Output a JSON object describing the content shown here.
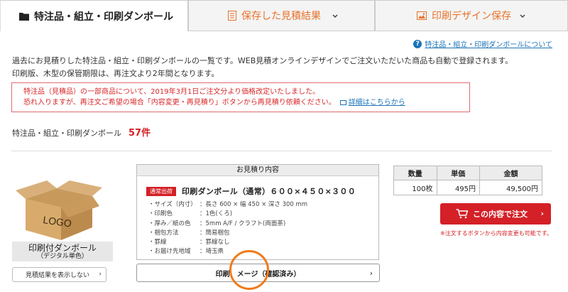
{
  "tabs": [
    {
      "label": "特注品・組立・印刷ダンボール",
      "active": true
    },
    {
      "label": "保存した見積結果"
    },
    {
      "label": "印刷デザイン保存"
    }
  ],
  "help_link": "特注品・組立・印刷ダンボールについて",
  "intro": {
    "line1": "過去にお見積りした特注品・組立・印刷ダンボールの一覧です。WEB見積オンラインデザインでご注文いただいた商品も自動で登録されます。",
    "line2": "印刷版、木型の保管期限は、再注文より2年間となります。"
  },
  "notice": {
    "line1": "特注品（見積品）の一部商品について、2019年3月1日ご注文分より価格改定いたしました。",
    "line2": "恐れ入りますが、再注文ご希望の場合「内容変更・再見積り」ボタンから再見積り依頼ください。",
    "link": "詳細はこちらから"
  },
  "count": {
    "label": "特注品・組立・印刷ダンボール",
    "value": "57件"
  },
  "product": {
    "logo_text": "LOGO",
    "name_l1": "印刷付ダンボール",
    "name_l2": "（デジタル単色）",
    "hide_button": "見積結果を表示しない"
  },
  "quote": {
    "header": "お見積り内容",
    "badge": "通常出荷",
    "title": "印刷ダンボール（通常）６００×４５０×３００",
    "specs": [
      {
        "k": "・サイズ（内寸）",
        "v": "：長さ 600 × 幅 450 × 深さ 300 mm"
      },
      {
        "k": "・印刷色",
        "v": "：1色(くろ)"
      },
      {
        "k": "・厚み／紙の色",
        "v": "：5mm A/F / クラフト(両面茶)"
      },
      {
        "k": "・梱包方法",
        "v": "：簡易梱包"
      },
      {
        "k": "・罫線",
        "v": "：罫線なし"
      },
      {
        "k": "・お届け先地域",
        "v": "：埼玉県"
      }
    ],
    "print_button": "印刷　メージ（確認済み）"
  },
  "price": {
    "headers": [
      "数量",
      "単価",
      "金額"
    ],
    "row": [
      "100枚",
      "495円",
      "49,500円"
    ]
  },
  "order": {
    "button": "この内容で注文",
    "note": "※注文するボタンから内容変更も可能です。"
  },
  "colors": {
    "accent": "#d42027",
    "tab_orange": "#e8722a",
    "link": "#1a73b8",
    "ring": "#f07a1a"
  }
}
